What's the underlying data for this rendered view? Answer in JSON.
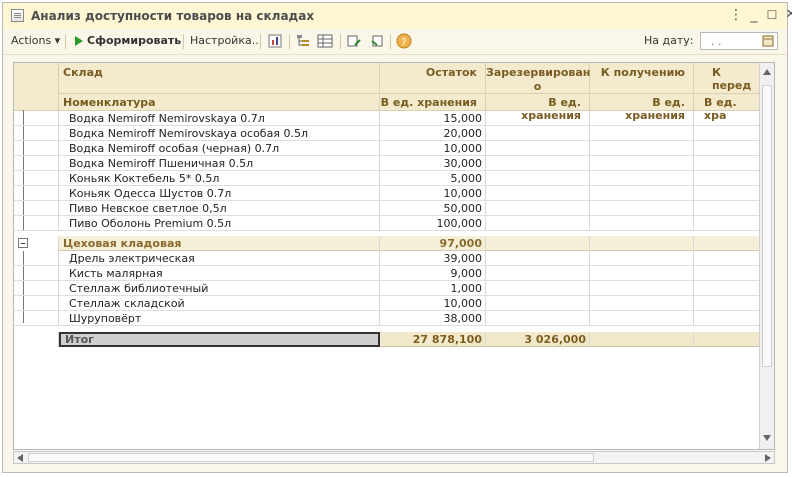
{
  "window": {
    "title": "Анализ доступности товаров на складах"
  },
  "toolbar": {
    "actions_label": "Actions ▾",
    "generate_label": "Сформировать",
    "settings_label": "Настройка...",
    "date_label": "На дату:",
    "date_value": ". ."
  },
  "table": {
    "headers_top": [
      "Склад",
      "Остаток",
      "Зарезервирован о",
      "К получению",
      "К перед"
    ],
    "headers_bottom": [
      "Номенклатура",
      "В ед. хранения",
      "В ед. хранения",
      "В ед. хранения",
      "В ед. хра"
    ],
    "rows": [
      {
        "name": "Водка Nemiroff Nemirovskaya 0.7л",
        "stock": "15,000",
        "reserved": "",
        "receive": "",
        "transfer": ""
      },
      {
        "name": "Водка Nemiroff Nemirovskaya особая 0.5л",
        "stock": "20,000",
        "reserved": "",
        "receive": "",
        "transfer": ""
      },
      {
        "name": "Водка Nemiroff особая (черная) 0.7л",
        "stock": "10,000",
        "reserved": "",
        "receive": "",
        "transfer": ""
      },
      {
        "name": "Водка Nemiroff Пшеничная 0.5л",
        "stock": "30,000",
        "reserved": "",
        "receive": "",
        "transfer": ""
      },
      {
        "name": "Коньяк Коктебель 5* 0.5л",
        "stock": "5,000",
        "reserved": "",
        "receive": "",
        "transfer": ""
      },
      {
        "name": "Коньяк Одесса Шустов 0.7л",
        "stock": "10,000",
        "reserved": "",
        "receive": "",
        "transfer": ""
      },
      {
        "name": "Пиво Невское светлое 0,5л",
        "stock": "50,000",
        "reserved": "",
        "receive": "",
        "transfer": ""
      },
      {
        "name": "Пиво Оболонь Premium 0.5л",
        "stock": "100,000",
        "reserved": "",
        "receive": "",
        "transfer": ""
      }
    ],
    "group": {
      "name": "Цеховая кладовая",
      "stock": "97,000"
    },
    "group_rows": [
      {
        "name": "Дрель электрическая",
        "stock": "39,000"
      },
      {
        "name": "Кисть малярная",
        "stock": "9,000"
      },
      {
        "name": "Стеллаж библиотечный",
        "stock": "1,000"
      },
      {
        "name": "Стеллаж складской",
        "stock": "10,000"
      },
      {
        "name": "Шуруповёрт",
        "stock": "38,000"
      }
    ],
    "total": {
      "name": "Итог",
      "stock": "27 878,100",
      "reserved": "3 026,000"
    }
  }
}
